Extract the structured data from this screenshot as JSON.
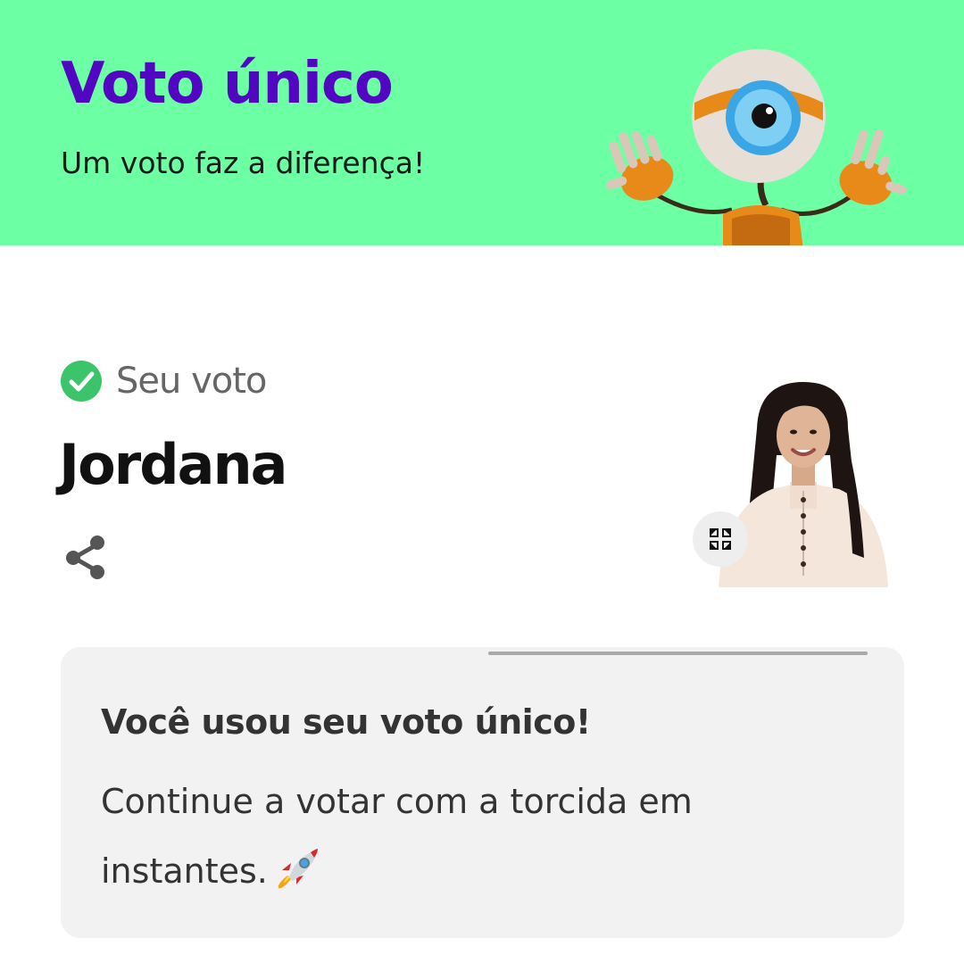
{
  "banner": {
    "title": "Voto único",
    "subtitle": "Um voto faz a diferença!",
    "background": "#6cffa4",
    "title_color": "#5206c2",
    "mascot_icon": "big-brother-eye-mascot"
  },
  "vote": {
    "status_label": "Seu voto",
    "status_icon": "check-circle-icon",
    "participant_name": "Jordana",
    "share_icon": "share-icon",
    "expand_icon": "expand-icon"
  },
  "card": {
    "title": "Você usou seu voto único!",
    "body": "Continue a votar com a torcida em instantes.",
    "emoji_icon": "rocket-icon"
  },
  "colors": {
    "success": "#3cc46a",
    "card_bg": "#f2f2f2",
    "text_dark": "#333333",
    "text_muted": "#666666"
  }
}
